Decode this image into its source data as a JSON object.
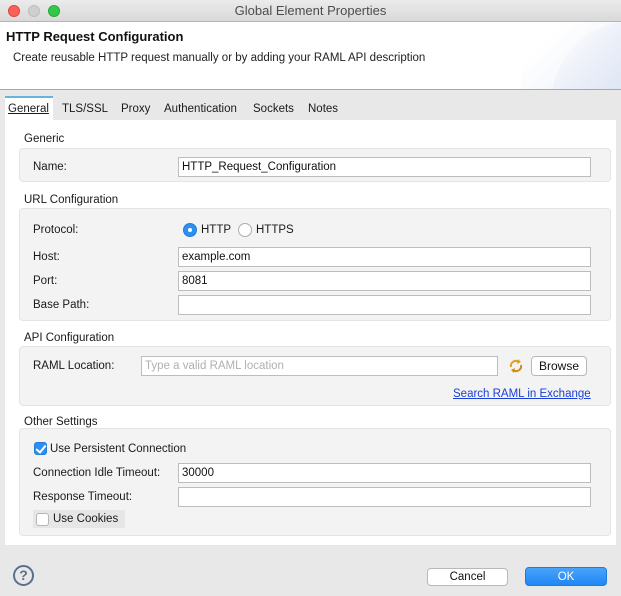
{
  "window": {
    "title": "Global Element Properties"
  },
  "header": {
    "title": "HTTP Request Configuration",
    "description": "Create reusable HTTP request manually or by adding your RAML API description"
  },
  "tabs": [
    {
      "label": "General",
      "active": true
    },
    {
      "label": "TLS/SSL",
      "active": false
    },
    {
      "label": "Proxy",
      "active": false
    },
    {
      "label": "Authentication",
      "active": false
    },
    {
      "label": "Sockets",
      "active": false
    },
    {
      "label": "Notes",
      "active": false
    }
  ],
  "generic": {
    "group_label": "Generic",
    "name_label": "Name:",
    "name_value": "HTTP_Request_Configuration"
  },
  "url_config": {
    "group_label": "URL Configuration",
    "protocol_label": "Protocol:",
    "protocol_options": [
      "HTTP",
      "HTTPS"
    ],
    "protocol_selected": "HTTP",
    "host_label": "Host:",
    "host_value": "example.com",
    "port_label": "Port:",
    "port_value": "8081",
    "base_path_label": "Base Path:",
    "base_path_value": ""
  },
  "api_config": {
    "group_label": "API Configuration",
    "raml_label": "RAML Location:",
    "raml_value": "",
    "raml_placeholder": "Type a valid RAML location",
    "browse_label": "Browse",
    "exchange_link": "Search RAML in Exchange"
  },
  "other_settings": {
    "group_label": "Other Settings",
    "persistent_label": "Use Persistent Connection",
    "persistent_checked": true,
    "idle_timeout_label": "Connection Idle Timeout:",
    "idle_timeout_value": "30000",
    "response_timeout_label": "Response Timeout:",
    "response_timeout_value": "",
    "cookies_label": "Use Cookies",
    "cookies_checked": false
  },
  "footer": {
    "help_glyph": "?",
    "cancel_label": "Cancel",
    "ok_label": "OK"
  },
  "colors": {
    "accent": "#2d8ff0",
    "tab_indicator": "#66b3de",
    "link": "#1a3fd8"
  }
}
